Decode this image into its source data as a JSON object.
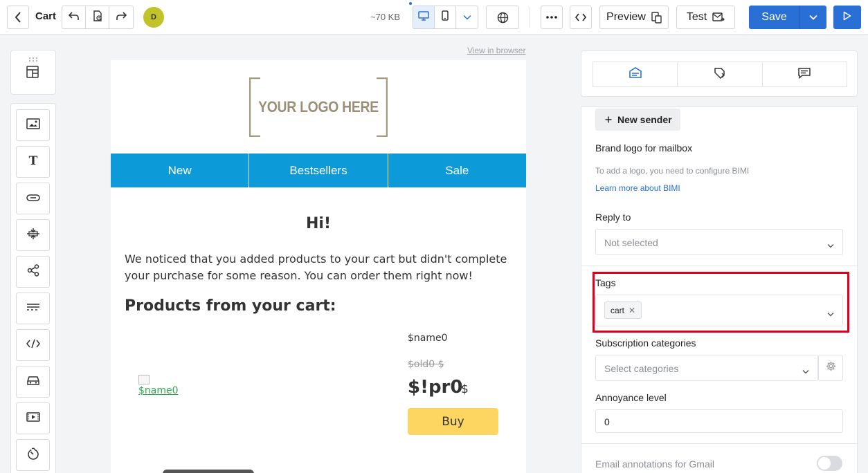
{
  "header": {
    "title": "Cart",
    "avatar_initial": "D",
    "size": "~70 KB",
    "preview_label": "Preview",
    "test_label": "Test",
    "save_label": "Save"
  },
  "canvas": {
    "view_in_browser": "View in browser",
    "logo_text": "YOUR LOGO HERE",
    "nav": [
      "New",
      "Bestsellers",
      "Sale"
    ],
    "greeting": "Hi!",
    "intro": "We noticed that you added products to your cart but didn't complete your purchase for some reason. You can order them right now!",
    "products_heading": "Products from your cart:",
    "product": {
      "image_alt": "$name0",
      "name": "$name0",
      "old_price": "$old0 $",
      "price": "$!pr0",
      "currency": "$",
      "buy_label": "Buy"
    }
  },
  "settings": {
    "new_sender_label": "New sender",
    "brand_logo_label": "Brand logo for mailbox",
    "bimi_hint": "To add a logo, you need to configure BIMI",
    "bimi_link": "Learn more about BIMI",
    "reply_to_label": "Reply to",
    "reply_to_placeholder": "Not selected",
    "tags_label": "Tags",
    "tags": [
      "cart"
    ],
    "subscription_label": "Subscription categories",
    "subscription_placeholder": "Select categories",
    "annoyance_label": "Annoyance level",
    "annoyance_value": "0",
    "gmail_label": "Email annotations for Gmail",
    "gmail_enabled": false
  },
  "colors": {
    "accent": "#2a6fd6",
    "nav_bar": "#0d9ad9",
    "buy_button": "#fdd662",
    "highlight": "#e0001b"
  },
  "icons": {
    "back": "chevron-left-icon",
    "undo": "undo-icon",
    "history": "history-icon",
    "redo": "redo-icon",
    "desktop": "desktop-icon",
    "mobile": "mobile-icon",
    "globe": "globe-icon",
    "more": "more-icon",
    "code": "code-icon",
    "play": "play-icon",
    "tools": [
      "image-block-icon",
      "text-block-icon",
      "button-block-icon",
      "spacer-block-icon",
      "social-block-icon",
      "divider-block-icon",
      "html-block-icon",
      "menu-block-icon",
      "video-block-icon",
      "timer-block-icon"
    ],
    "tabs": [
      "email-settings-icon",
      "tag-settings-icon",
      "message-icon"
    ]
  }
}
